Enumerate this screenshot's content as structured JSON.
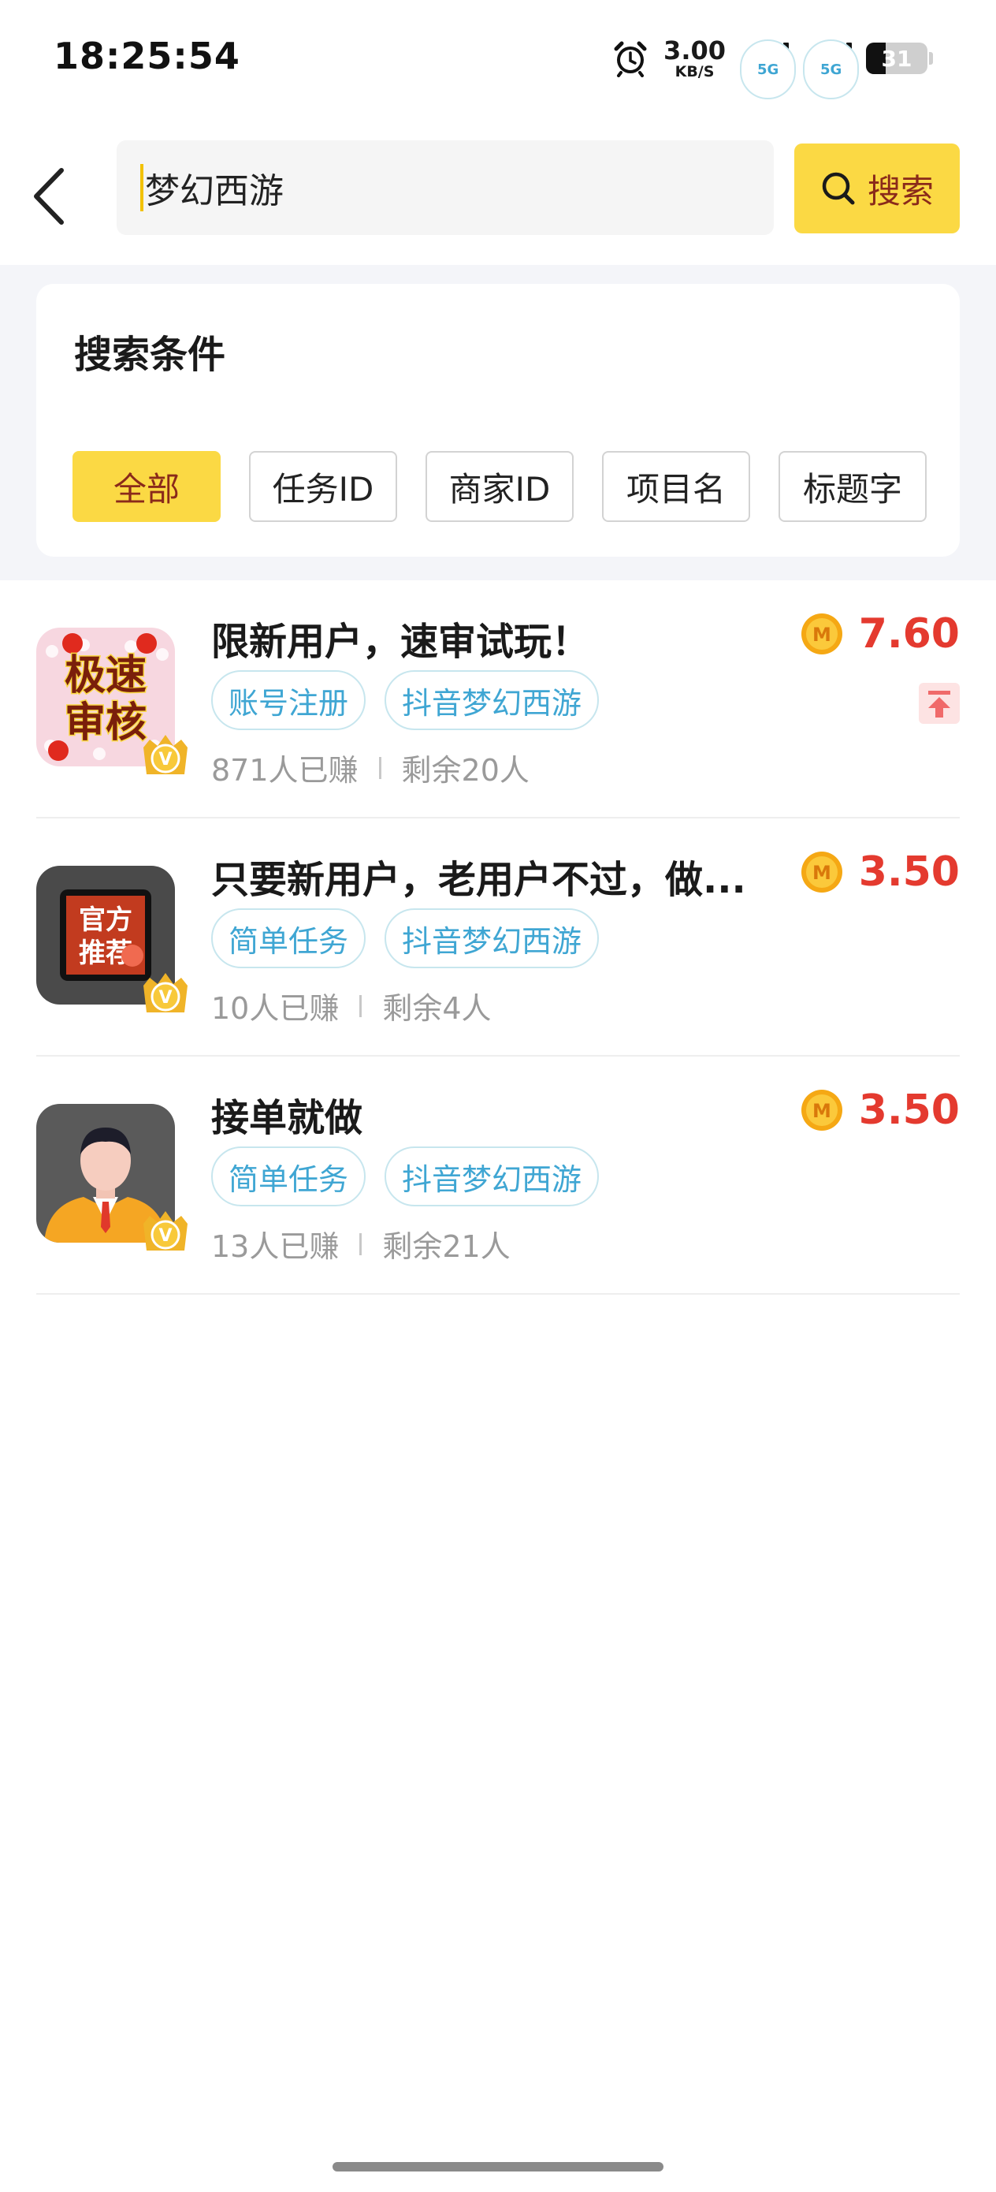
{
  "status_bar": {
    "time": "18:25:54",
    "net_speed_value": "3.00",
    "net_speed_unit": "KB/S",
    "signal1_tag": "5G",
    "signal2_tag": "5G",
    "battery": "31"
  },
  "search": {
    "value": "梦幻西游",
    "button_label": "搜索"
  },
  "conditions": {
    "title": "搜索条件",
    "chips": [
      "全部",
      "任务ID",
      "商家ID",
      "项目名",
      "标题字"
    ],
    "active_index": 0
  },
  "tasks": [
    {
      "title": "限新用户，速审试玩！",
      "tags": [
        "账号注册",
        "抖音梦幻西游"
      ],
      "earned": "871人已赚",
      "remaining": "剩余20人",
      "price": "7.60",
      "thumb_text_1": "极速",
      "thumb_text_2": "审核",
      "pinned": true
    },
    {
      "title": "只要新用户，老用户不过，做...",
      "tags": [
        "简单任务",
        "抖音梦幻西游"
      ],
      "earned": "10人已赚",
      "remaining": "剩余4人",
      "price": "3.50",
      "thumb_text_1": "官方",
      "thumb_text_2": "推荐"
    },
    {
      "title": "接单就做",
      "tags": [
        "简单任务",
        "抖音梦幻西游"
      ],
      "earned": "13人已赚",
      "remaining": "剩余21人",
      "price": "3.50"
    }
  ],
  "colors": {
    "accent_yellow": "#fbd944",
    "price_red": "#e43a2f",
    "tag_blue": "#3fa6d3"
  }
}
